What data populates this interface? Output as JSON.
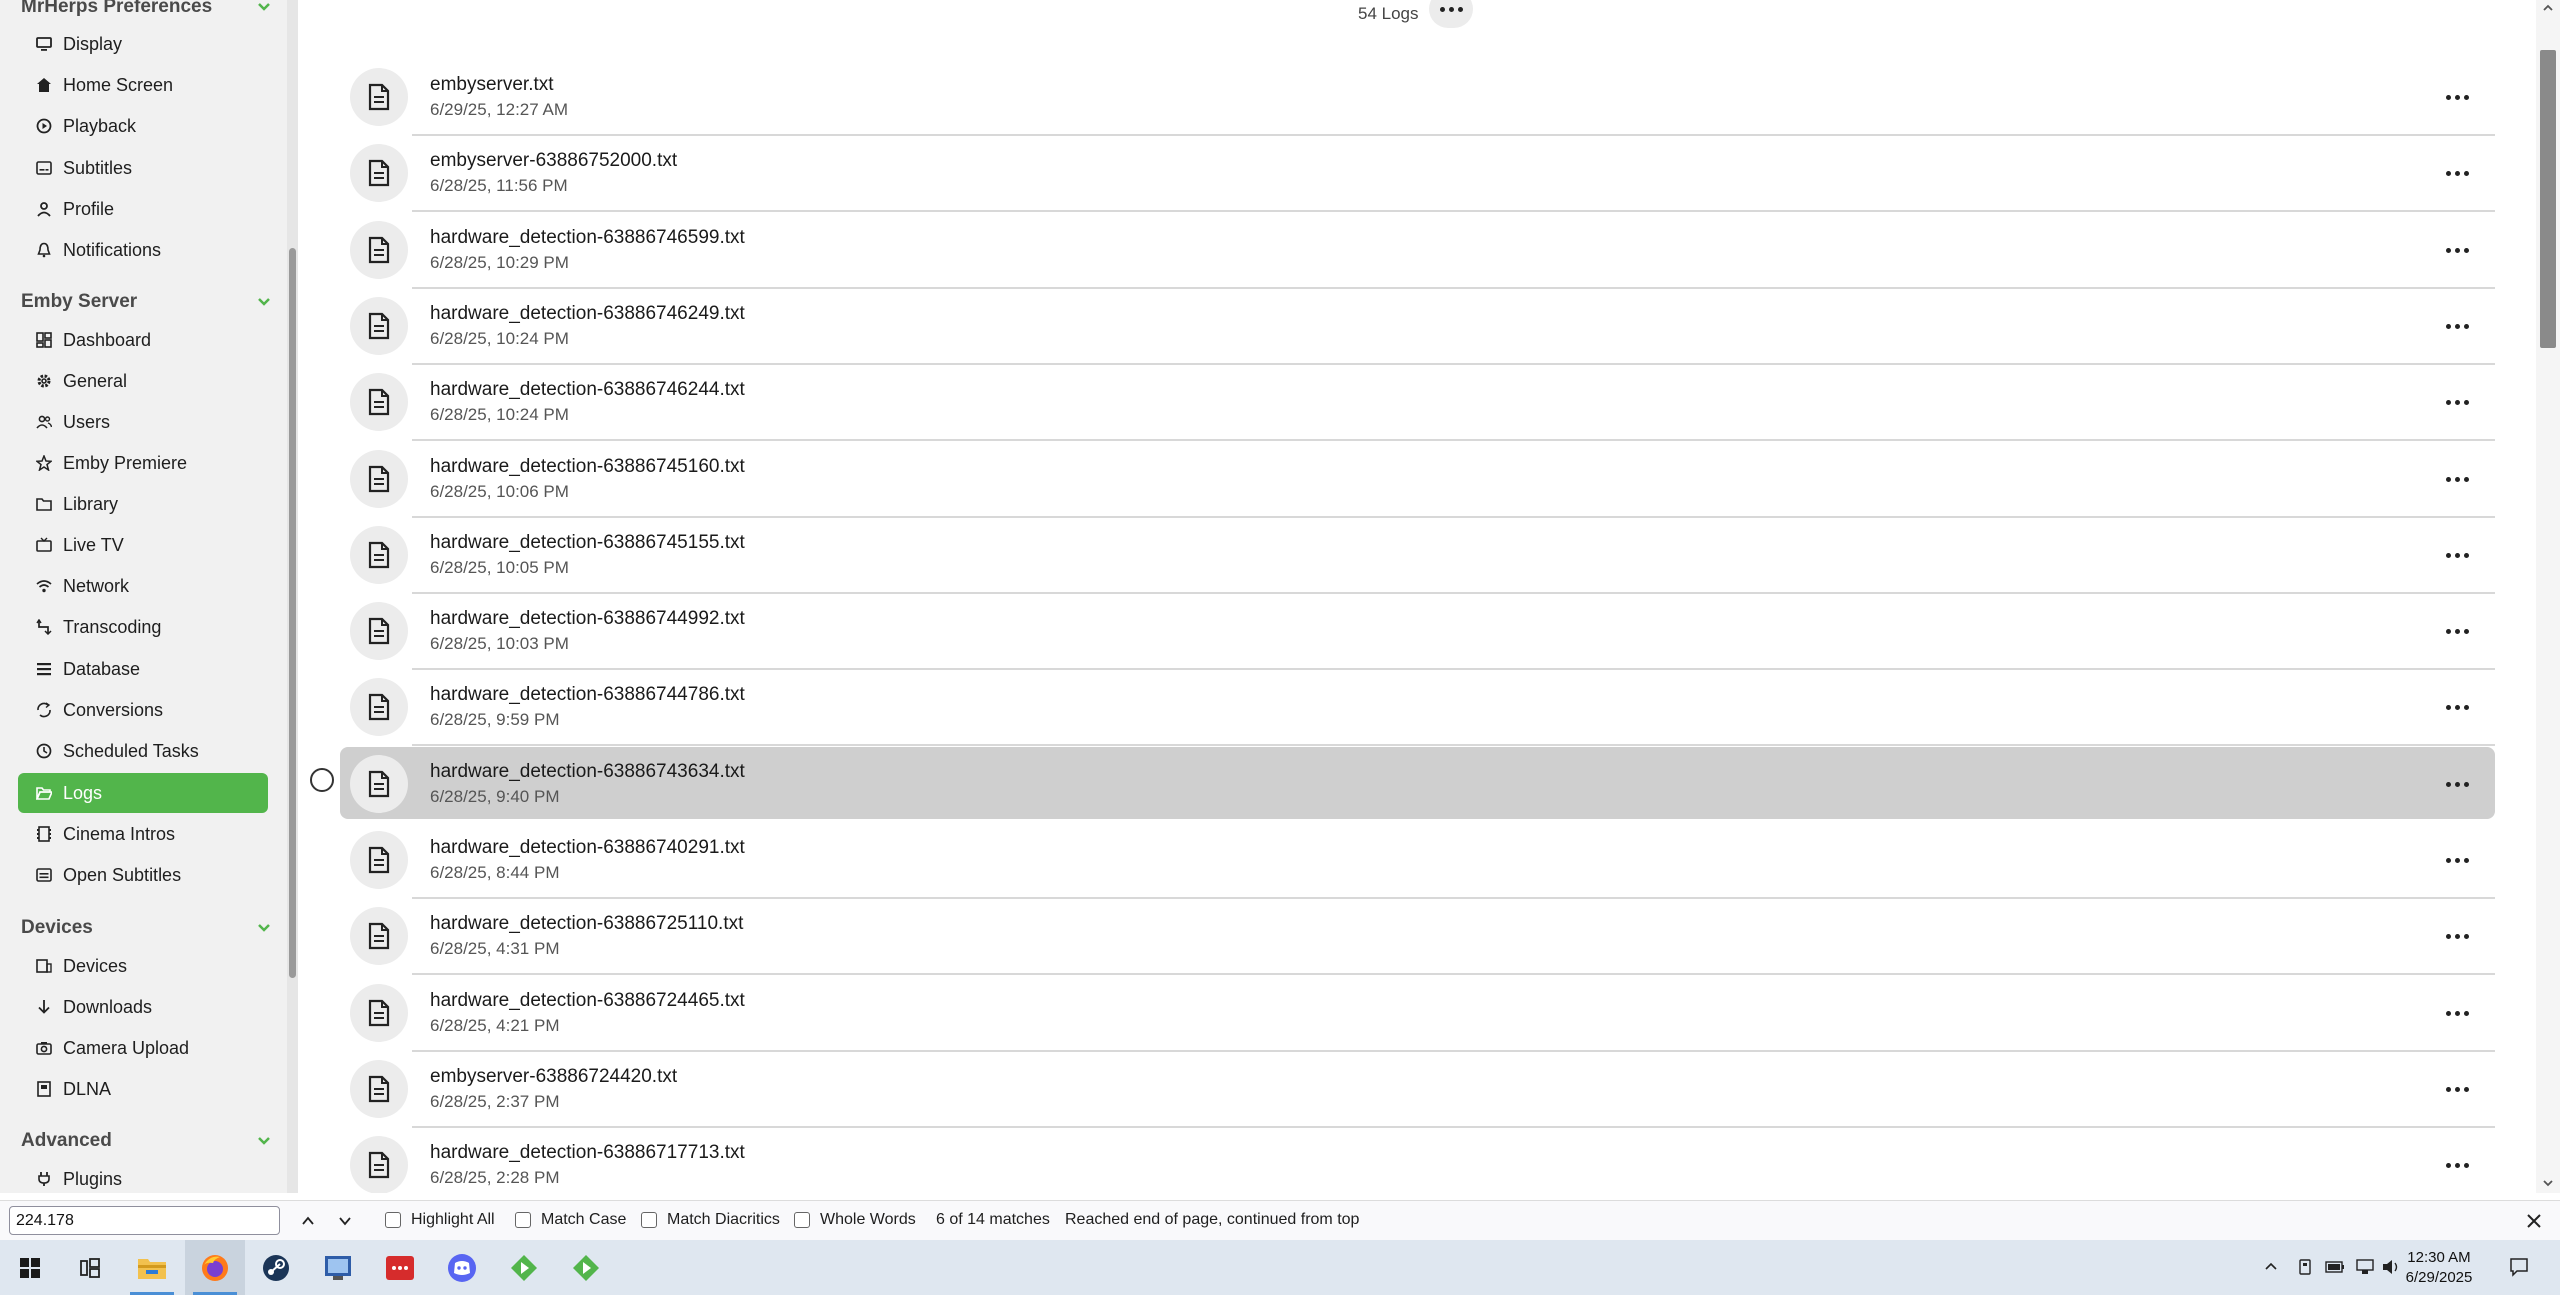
{
  "sidebar": {
    "sections": [
      {
        "title": "MrHerps Preferences"
      },
      {
        "title": "Emby Server"
      },
      {
        "title": "Devices"
      },
      {
        "title": "Advanced"
      }
    ],
    "items": [
      {
        "label": "Display",
        "icon": "monitor-icon"
      },
      {
        "label": "Home Screen",
        "icon": "home-icon"
      },
      {
        "label": "Playback",
        "icon": "play-circle-icon"
      },
      {
        "label": "Subtitles",
        "icon": "subtitles-icon"
      },
      {
        "label": "Profile",
        "icon": "person-icon"
      },
      {
        "label": "Notifications",
        "icon": "bell-icon"
      },
      {
        "label": "Dashboard",
        "icon": "dashboard-icon"
      },
      {
        "label": "General",
        "icon": "gear-icon"
      },
      {
        "label": "Users",
        "icon": "users-icon"
      },
      {
        "label": "Emby Premiere",
        "icon": "star-icon"
      },
      {
        "label": "Library",
        "icon": "folder-icon"
      },
      {
        "label": "Live TV",
        "icon": "tv-icon"
      },
      {
        "label": "Network",
        "icon": "wifi-icon"
      },
      {
        "label": "Transcoding",
        "icon": "transcode-icon"
      },
      {
        "label": "Database",
        "icon": "list-icon"
      },
      {
        "label": "Conversions",
        "icon": "convert-icon"
      },
      {
        "label": "Scheduled Tasks",
        "icon": "clock-icon"
      },
      {
        "label": "Logs",
        "icon": "folder-open-icon"
      },
      {
        "label": "Cinema Intros",
        "icon": "film-icon"
      },
      {
        "label": "Open Subtitles",
        "icon": "subtitles-box-icon"
      },
      {
        "label": "Devices",
        "icon": "devices-icon"
      },
      {
        "label": "Downloads",
        "icon": "download-icon"
      },
      {
        "label": "Camera Upload",
        "icon": "camera-icon"
      },
      {
        "label": "DLNA",
        "icon": "dlna-icon"
      },
      {
        "label": "Plugins",
        "icon": "plug-icon"
      }
    ],
    "active_item": "Logs"
  },
  "main": {
    "header": "54 Logs",
    "logs": [
      {
        "name": "embyserver.txt",
        "date": "6/29/25, 12:27 AM"
      },
      {
        "name": "embyserver-63886752000.txt",
        "date": "6/28/25, 11:56 PM"
      },
      {
        "name": "hardware_detection-63886746599.txt",
        "date": "6/28/25, 10:29 PM"
      },
      {
        "name": "hardware_detection-63886746249.txt",
        "date": "6/28/25, 10:24 PM"
      },
      {
        "name": "hardware_detection-63886746244.txt",
        "date": "6/28/25, 10:24 PM"
      },
      {
        "name": "hardware_detection-63886745160.txt",
        "date": "6/28/25, 10:06 PM"
      },
      {
        "name": "hardware_detection-63886745155.txt",
        "date": "6/28/25, 10:05 PM"
      },
      {
        "name": "hardware_detection-63886744992.txt",
        "date": "6/28/25, 10:03 PM"
      },
      {
        "name": "hardware_detection-63886744786.txt",
        "date": "6/28/25, 9:59 PM"
      },
      {
        "name": "hardware_detection-63886743634.txt",
        "date": "6/28/25, 9:40 PM"
      },
      {
        "name": "hardware_detection-63886740291.txt",
        "date": "6/28/25, 8:44 PM"
      },
      {
        "name": "hardware_detection-63886725110.txt",
        "date": "6/28/25, 4:31 PM"
      },
      {
        "name": "hardware_detection-63886724465.txt",
        "date": "6/28/25, 4:21 PM"
      },
      {
        "name": "embyserver-63886724420.txt",
        "date": "6/28/25, 2:37 PM"
      },
      {
        "name": "hardware_detection-63886717713.txt",
        "date": "6/28/25, 2:28 PM"
      }
    ],
    "highlighted_index": 9
  },
  "findbar": {
    "query": "224.178",
    "highlight_all": "Highlight All",
    "match_case": "Match Case",
    "match_diacritics": "Match Diacritics",
    "whole_words": "Whole Words",
    "match_count": "6 of 14 matches",
    "status": "Reached end of page, continued from top"
  },
  "taskbar": {
    "apps": [
      "windows-start-icon",
      "task-view-icon",
      "file-explorer-icon",
      "firefox-icon",
      "steam-icon",
      "app-icon",
      "red-app-icon",
      "discord-icon",
      "green-play-icon",
      "green-play-icon-2"
    ],
    "time": "12:30 AM",
    "date": "6/29/2025"
  },
  "colors": {
    "accent": "#52b54b",
    "highlight_row": "#cfcfcf"
  }
}
